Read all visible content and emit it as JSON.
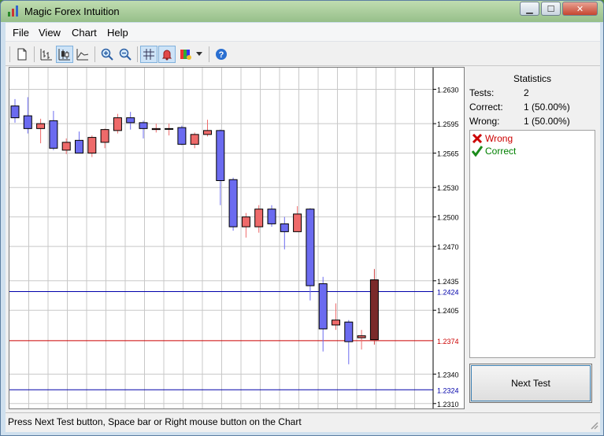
{
  "window": {
    "title": "Magic Forex Intuition"
  },
  "menu": [
    "File",
    "View",
    "Chart",
    "Help"
  ],
  "toolbar": {
    "buttons": [
      "new-icon",
      "bar-chart-icon",
      "candlestick-icon",
      "line-chart-icon",
      "zoom-in-icon",
      "zoom-out-icon",
      "grid-icon",
      "alert-bell-icon",
      "color-scheme-icon",
      "dropdown-arrow-icon",
      "help-icon"
    ],
    "active": [
      "candlestick-icon",
      "grid-icon"
    ]
  },
  "statistics": {
    "title": "Statistics",
    "rows": [
      {
        "label": "Tests:",
        "value": "2"
      },
      {
        "label": "Correct:",
        "value": "1 (50.00%)"
      },
      {
        "label": "Wrong:",
        "value": "1 (50.00%)"
      }
    ]
  },
  "log": [
    {
      "icon": "cross-icon",
      "text": "Wrong",
      "color": "#cc0000"
    },
    {
      "icon": "check-icon",
      "text": "Correct",
      "color": "#008000"
    }
  ],
  "next_test_label": "Next Test",
  "status_text": "Press Next Test button, Space bar or Right mouse button on the Chart",
  "colors": {
    "bull": "#ee6a6a",
    "bear": "#6b6bf0",
    "current": "#7a2a2a",
    "level_blue": "#0000aa",
    "level_red": "#cc0000"
  },
  "chart_data": {
    "type": "candlestick",
    "y_ticks": [
      "1.2630",
      "1.2595",
      "1.2565",
      "1.2530",
      "1.2500",
      "1.2470",
      "1.2435",
      "1.2405",
      "1.2340",
      "1.2310"
    ],
    "ylim": [
      1.2305,
      1.2652
    ],
    "levels": [
      {
        "value": 1.2424,
        "label": "1.2424",
        "color": "#0000aa"
      },
      {
        "value": 1.2374,
        "label": "1.2374",
        "color": "#cc0000"
      },
      {
        "value": 1.2324,
        "label": "1.2324",
        "color": "#0000aa"
      }
    ],
    "candles": [
      {
        "o": 1.2613,
        "h": 1.262,
        "l": 1.2596,
        "c": 1.2601
      },
      {
        "o": 1.2603,
        "h": 1.2622,
        "l": 1.2585,
        "c": 1.259
      },
      {
        "o": 1.259,
        "h": 1.26,
        "l": 1.2575,
        "c": 1.2595
      },
      {
        "o": 1.2598,
        "h": 1.2608,
        "l": 1.2568,
        "c": 1.257
      },
      {
        "o": 1.2568,
        "h": 1.258,
        "l": 1.2564,
        "c": 1.2576
      },
      {
        "o": 1.2578,
        "h": 1.2587,
        "l": 1.2565,
        "c": 1.2565
      },
      {
        "o": 1.2565,
        "h": 1.2583,
        "l": 1.2561,
        "c": 1.2581
      },
      {
        "o": 1.2576,
        "h": 1.259,
        "l": 1.257,
        "c": 1.2589
      },
      {
        "o": 1.2588,
        "h": 1.2605,
        "l": 1.2585,
        "c": 1.2601
      },
      {
        "o": 1.2601,
        "h": 1.2607,
        "l": 1.2589,
        "c": 1.2596
      },
      {
        "o": 1.2596,
        "h": 1.2598,
        "l": 1.258,
        "c": 1.259
      },
      {
        "o": 1.2589,
        "h": 1.2595,
        "l": 1.2586,
        "c": 1.259
      },
      {
        "o": 1.259,
        "h": 1.2595,
        "l": 1.2583,
        "c": 1.259
      },
      {
        "o": 1.2591,
        "h": 1.2593,
        "l": 1.2573,
        "c": 1.2574
      },
      {
        "o": 1.2574,
        "h": 1.2586,
        "l": 1.257,
        "c": 1.2584
      },
      {
        "o": 1.2584,
        "h": 1.2599,
        "l": 1.2582,
        "c": 1.2588
      },
      {
        "o": 1.2588,
        "h": 1.2589,
        "l": 1.2512,
        "c": 1.2537
      },
      {
        "o": 1.2538,
        "h": 1.254,
        "l": 1.2486,
        "c": 1.249
      },
      {
        "o": 1.249,
        "h": 1.2504,
        "l": 1.2479,
        "c": 1.25
      },
      {
        "o": 1.249,
        "h": 1.2512,
        "l": 1.2484,
        "c": 1.2508
      },
      {
        "o": 1.2508,
        "h": 1.2512,
        "l": 1.249,
        "c": 1.2493
      },
      {
        "o": 1.2493,
        "h": 1.25,
        "l": 1.2467,
        "c": 1.2485
      },
      {
        "o": 1.2485,
        "h": 1.2511,
        "l": 1.2485,
        "c": 1.2503
      },
      {
        "o": 1.2508,
        "h": 1.2509,
        "l": 1.2415,
        "c": 1.243
      },
      {
        "o": 1.2432,
        "h": 1.2439,
        "l": 1.2363,
        "c": 1.2386
      },
      {
        "o": 1.239,
        "h": 1.2412,
        "l": 1.2385,
        "c": 1.2395
      },
      {
        "o": 1.2393,
        "h": 1.2395,
        "l": 1.235,
        "c": 1.2373
      },
      {
        "o": 1.2377,
        "h": 1.2385,
        "l": 1.2365,
        "c": 1.2379
      },
      {
        "o": 1.2375,
        "h": 1.2447,
        "l": 1.237,
        "c": 1.2436
      }
    ]
  }
}
